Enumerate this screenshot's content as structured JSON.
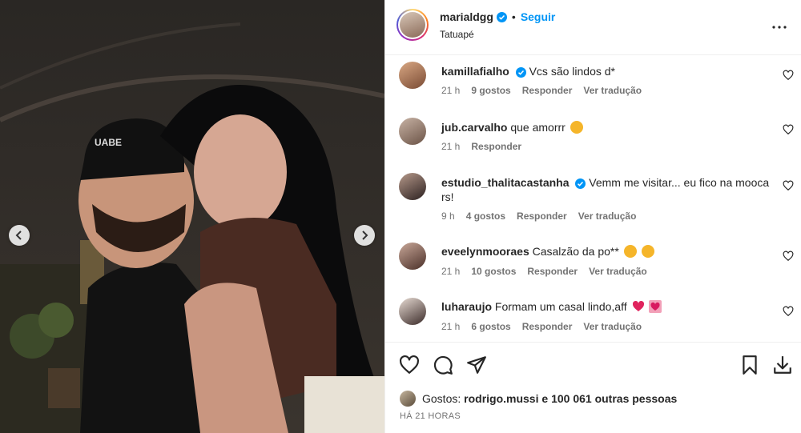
{
  "post": {
    "username": "marialdgg",
    "follow_label": "Seguir",
    "separator": "•",
    "location": "Tatuapé",
    "time_ago": "HÁ 21 HORAS"
  },
  "likes": {
    "prefix": "Gostos:",
    "user": "rodrigo.mussi",
    "rest": "e 100 061 outras pessoas"
  },
  "comments": [
    {
      "user": "kamillafialho",
      "verified": true,
      "text": "Vcs são lindos d*",
      "text2": "",
      "time": "21 h",
      "likes": "9 gostos",
      "reply": "Responder",
      "translate": "Ver tradução"
    },
    {
      "user": "jub.carvalho",
      "verified": false,
      "text": "que amorrr",
      "text2": "",
      "time": "21 h",
      "likes": "",
      "reply": "Responder",
      "translate": ""
    },
    {
      "user": "estudio_thalitacastanha",
      "verified": true,
      "text": "Vemm me visitar... eu fico na mooca",
      "text2": "rs!",
      "time": "9 h",
      "likes": "4 gostos",
      "reply": "Responder",
      "translate": "Ver tradução"
    },
    {
      "user": "eveelynmooraes",
      "verified": false,
      "text": "Casalzão da po**",
      "text2": "",
      "time": "21 h",
      "likes": "10 gostos",
      "reply": "Responder",
      "translate": "Ver tradução"
    },
    {
      "user": "luharaujo",
      "verified": false,
      "text": "Formam um casal lindo,aff",
      "text2": "",
      "time": "21 h",
      "likes": "6 gostos",
      "reply": "Responder",
      "translate": "Ver tradução"
    }
  ],
  "colors": {
    "link_blue": "#0095f6",
    "verified_blue": "#0095f6",
    "text": "#262626",
    "muted": "#737373"
  }
}
